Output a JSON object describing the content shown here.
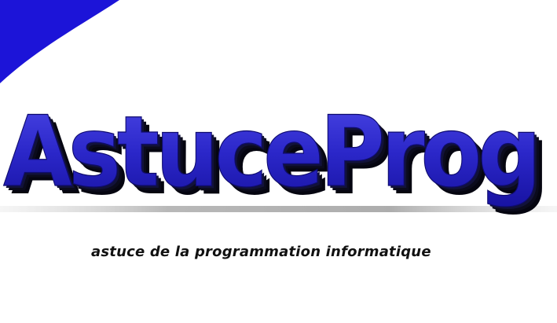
{
  "brand": {
    "name": "AstuceProg",
    "tagline": "astuce de la programmation informatique"
  },
  "colors": {
    "accent_blue": "#2a22cf",
    "corner_blue": "#1c14d8",
    "logo_fill": "#2b27c9",
    "logo_extrusion": "#050510",
    "tagline_color": "#111111",
    "background": "#ffffff"
  }
}
